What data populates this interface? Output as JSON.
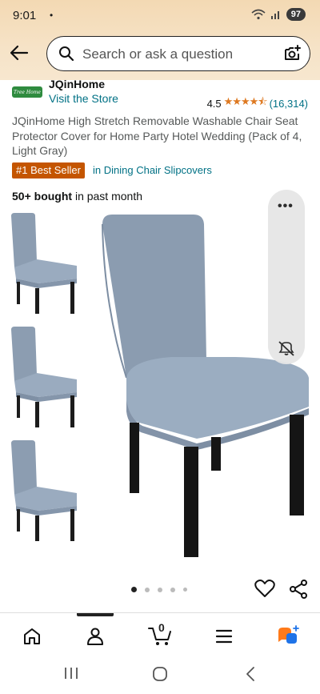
{
  "status": {
    "time": "9:01",
    "dot": "•",
    "battery": "97"
  },
  "search": {
    "placeholder": "Search or ask a question"
  },
  "brand": {
    "logo_text": "Tree Home",
    "name": "JQinHome",
    "visit_store": "Visit the Store",
    "rating": "4.5",
    "stars": "★★★★⯪",
    "review_count": "(16,314)"
  },
  "product": {
    "title": "JQinHome High Stretch Removable Washable Chair Seat Protector Cover for Home Party Hotel Wedding (Pack of 4, Light Gray)",
    "badge": "#1 Best Seller",
    "badge_category": "in Dining Chair Slipcovers",
    "bought_bold": "50+ bought",
    "bought_rest": " in past month"
  },
  "media": {
    "menu_label": "•••"
  },
  "carousel": {
    "count": 5,
    "active": 0
  },
  "bottom_nav": {
    "cart_count": "0"
  },
  "colors": {
    "accent_orange": "#c45500",
    "link": "#007185",
    "star": "#de7921",
    "header_bg": "#f3d9b3",
    "chair_gray": "#8b9cb0"
  }
}
